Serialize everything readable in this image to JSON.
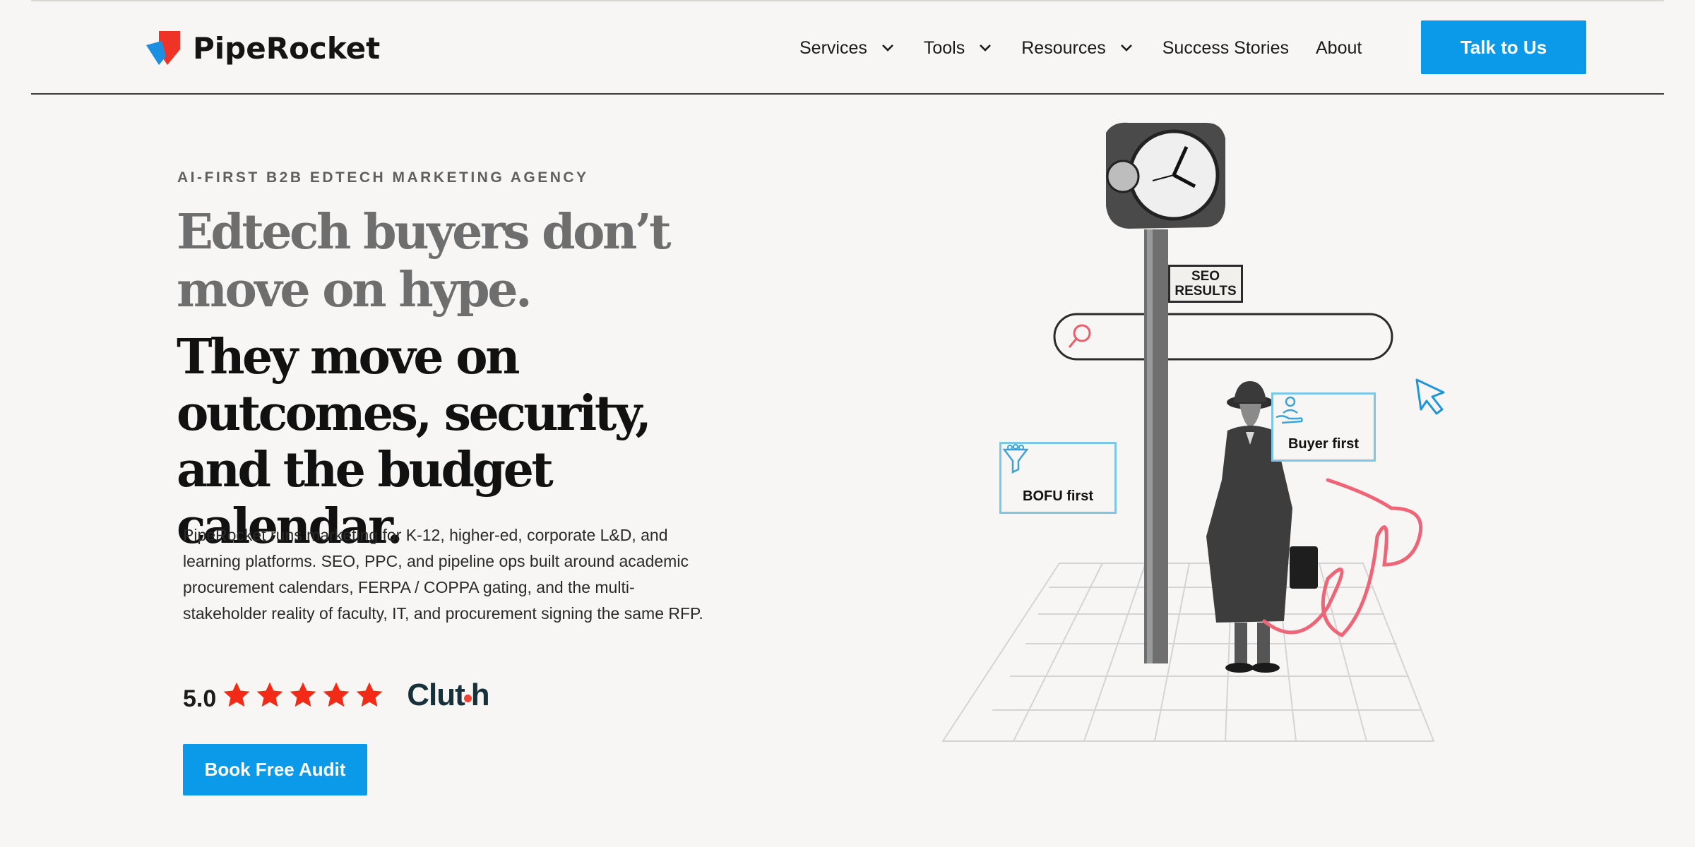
{
  "brand": {
    "name": "PipeRocket",
    "accent": "#0b99ea",
    "logo_red": "#ef3326",
    "logo_blue": "#1d8fe3"
  },
  "nav": {
    "items": [
      {
        "label": "Services",
        "dropdown": true
      },
      {
        "label": "Tools",
        "dropdown": true
      },
      {
        "label": "Resources",
        "dropdown": true
      },
      {
        "label": "Success Stories",
        "dropdown": false
      },
      {
        "label": "About",
        "dropdown": false
      }
    ],
    "cta": "Talk to Us"
  },
  "hero": {
    "eyebrow": "AI-FIRST B2B EDTECH MARKETING AGENCY",
    "headline_light": "Edtech buyers don’t move on hype.",
    "headline_dark": "They move on outcomes, security, and the budget calendar.",
    "body": "PipeRocket runs marketing for K-12, higher-ed, corporate L&D, and learning platforms. SEO, PPC, and pipeline ops built around academic procurement calendars, FERPA / COPPA gating, and the multi-stakeholder reality of faculty, IT, and procurement signing the same RFP.",
    "rating": {
      "score": "5.0",
      "stars": 5,
      "star_color": "#f22a16",
      "source": "Clutch"
    },
    "cta": "Book Free Audit"
  },
  "illustration": {
    "sign_line1": "SEO",
    "sign_line2": "RESULTS",
    "card_left": "BOFU first",
    "card_right": "Buyer first",
    "icons": [
      "search-icon",
      "funnel-icon",
      "hand-person-icon",
      "cursor-icon"
    ]
  }
}
